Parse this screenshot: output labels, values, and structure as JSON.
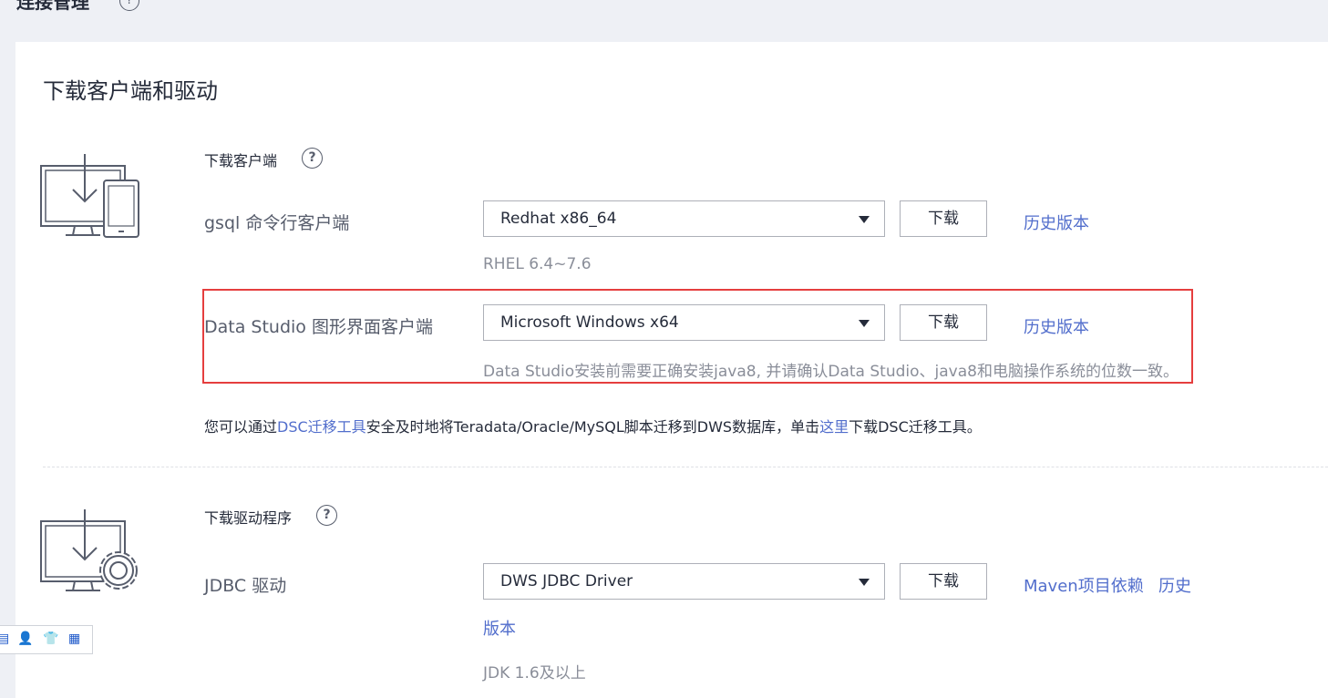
{
  "header": {
    "title": "连接管理",
    "help_glyph": "?"
  },
  "card_title": "下载客户端和驱动",
  "client_section": {
    "label": "下载客户端",
    "help_glyph": "?",
    "icon": "monitor-download-icon",
    "rows": [
      {
        "label": "gsql 命令行客户端",
        "selected": "Redhat x86_64",
        "button": "下载",
        "link": "历史版本",
        "hint": "RHEL 6.4~7.6"
      },
      {
        "label": "Data Studio 图形界面客户端",
        "selected": "Microsoft Windows x64",
        "button": "下载",
        "link": "历史版本",
        "hint": "Data Studio安装前需要正确安装java8, 并请确认Data Studio、java8和电脑操作系统的位数一致。"
      }
    ],
    "note": {
      "part1": "您可以通过",
      "link1": "DSC迁移工具",
      "part2": "安全及时地将Teradata/Oracle/MySQL脚本迁移到DWS数据库，单击",
      "link2": "这里",
      "part3": "下载DSC迁移工具。"
    }
  },
  "driver_section": {
    "label": "下载驱动程序",
    "help_glyph": "?",
    "icon": "monitor-gear-download-icon",
    "rows": [
      {
        "label": "JDBC 驱动",
        "selected": "DWS JDBC Driver",
        "button": "下载",
        "link_maven": "Maven项目依赖",
        "link_history_1": "历史",
        "link_history_2": "版本",
        "hint": "JDK 1.6及以上"
      }
    ]
  },
  "colors": {
    "accent_link": "#526ecc",
    "highlight": "#e53e3e",
    "muted": "#8a8e99"
  }
}
